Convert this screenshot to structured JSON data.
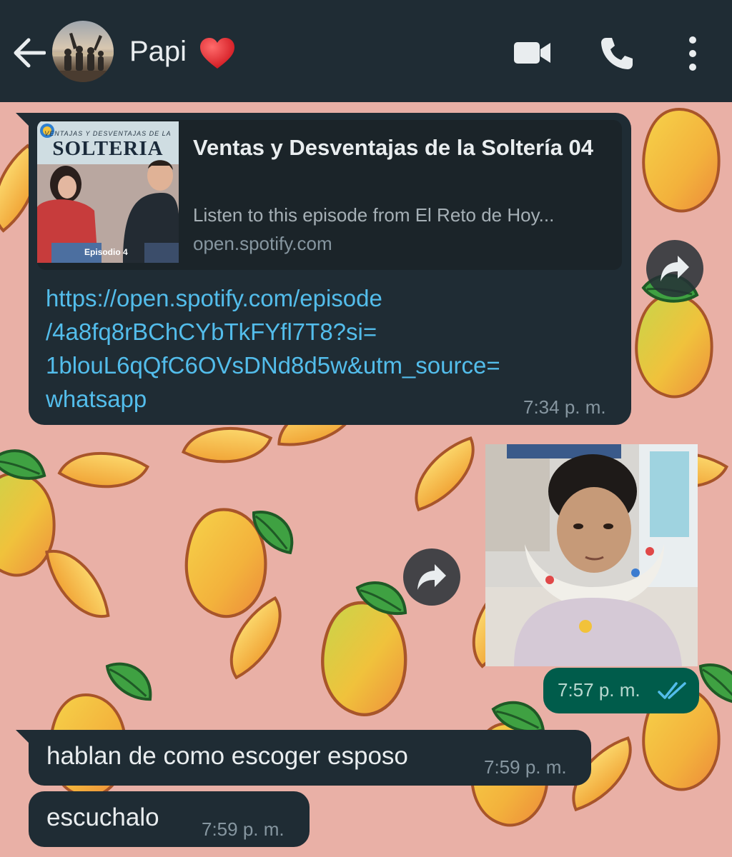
{
  "header": {
    "contact_name": "Papi",
    "icons": [
      "back-arrow-icon",
      "avatar",
      "heart-icon",
      "video-call-icon",
      "voice-call-icon",
      "more-options-icon"
    ]
  },
  "messages": [
    {
      "type": "incoming-link",
      "preview_thumb_subtitle": "VENTAJAS Y DESVENTAJAS DE LA",
      "preview_thumb_title": "SOLTERIA",
      "preview_thumb_badge": "Episodio 4",
      "preview_title": "Ventas y Desventajas de la Soltería 04",
      "preview_description": "Listen to this episode from El Reto de Hoy...",
      "preview_domain": "open.spotify.com",
      "link_lines": [
        "https://open.spotify.com/episode",
        "/4a8fq8rBChCYbTkFYfl7T8?si=",
        "1blouL6qQfC6OVsDNd8d5w&utm_source=",
        "whatsapp"
      ],
      "time": "7:34 p. m."
    },
    {
      "type": "outgoing-photo",
      "time": "7:57 p. m.",
      "status": "read"
    },
    {
      "type": "incoming-text",
      "text": "hablan de como escoger esposo",
      "time": "7:59 p. m."
    },
    {
      "type": "incoming-text",
      "text": "escuchalo",
      "time": "7:59 p. m."
    }
  ],
  "colors": {
    "header_bg": "#1f2c34",
    "bubble_in": "#1f2c34",
    "bubble_out": "#005c4b",
    "link": "#53bdeb",
    "wallpaper": "#e9b0a6",
    "read_ticks": "#53bdeb"
  }
}
